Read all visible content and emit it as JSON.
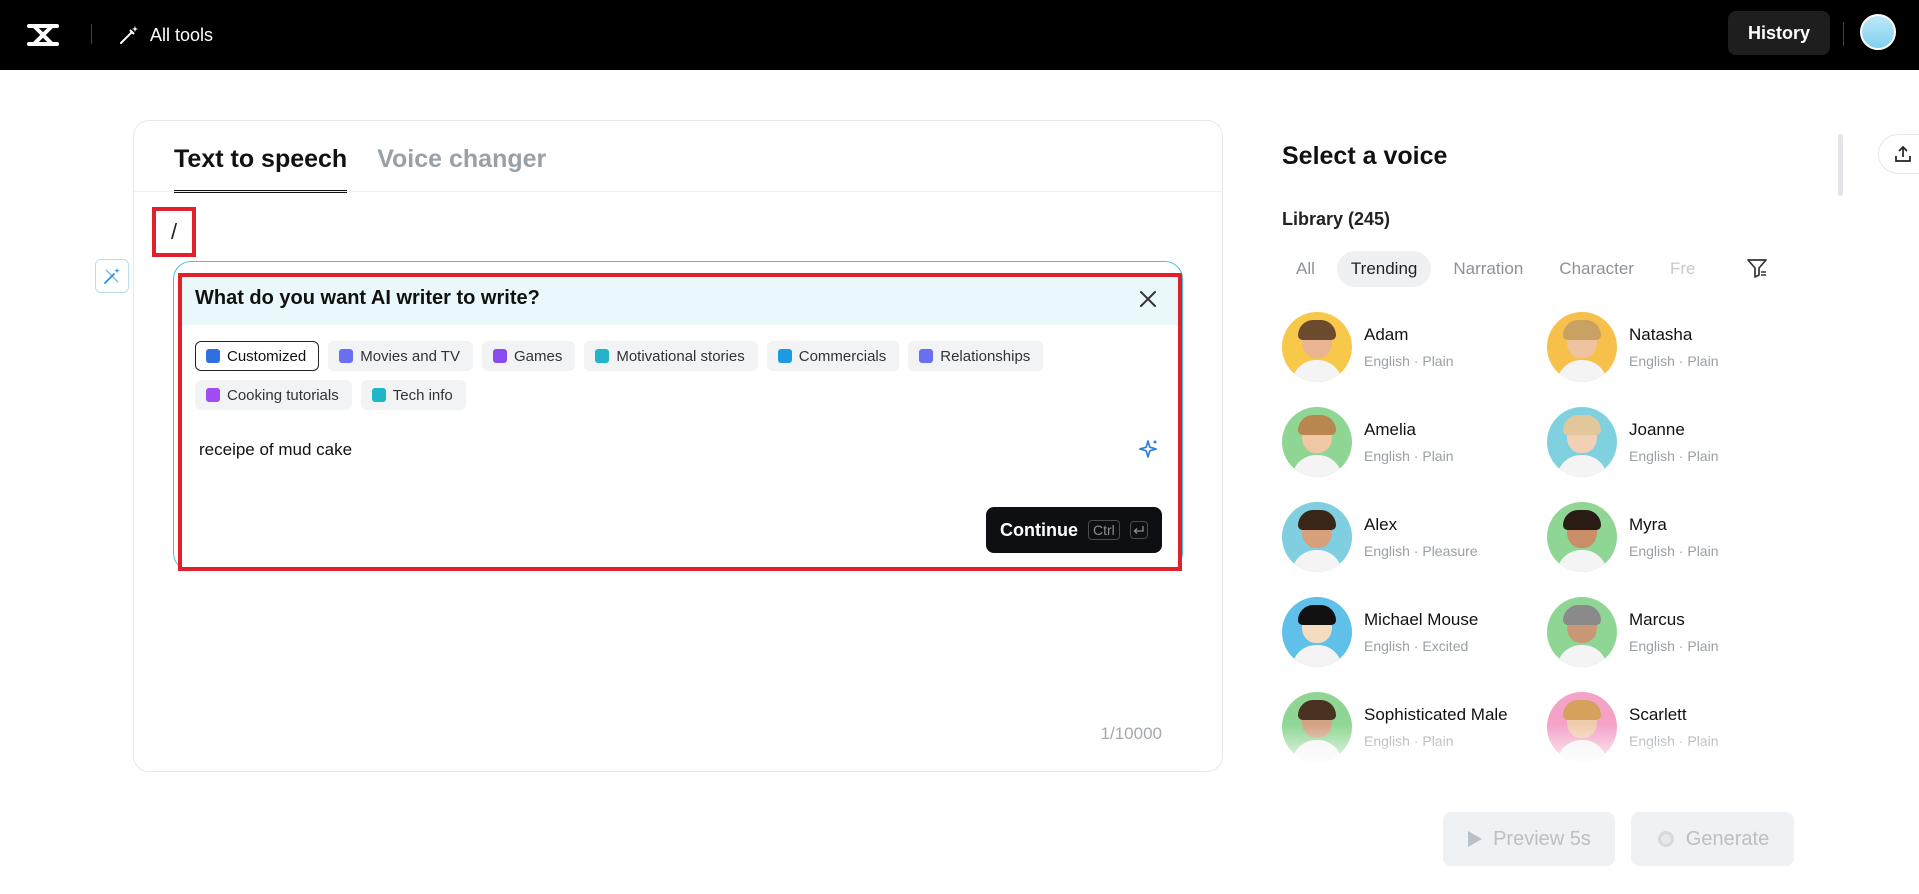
{
  "topbar": {
    "all_tools_label": "All tools",
    "history_label": "History"
  },
  "editor": {
    "tabs": [
      {
        "label": "Text to speech",
        "active": true
      },
      {
        "label": "Voice changer",
        "active": false
      }
    ],
    "text_content": "/",
    "char_count": "1/10000"
  },
  "ai_writer": {
    "title": "What do you want AI writer to write?",
    "categories": [
      {
        "label": "Customized",
        "active": true,
        "icon": "edit-icon",
        "color": "#2f6fe0"
      },
      {
        "label": "Movies and TV",
        "active": false,
        "icon": "clapperboard-icon",
        "color": "#6a6ef0"
      },
      {
        "label": "Games",
        "active": false,
        "icon": "gamepad-icon",
        "color": "#8a4bf0"
      },
      {
        "label": "Motivational stories",
        "active": false,
        "icon": "person-icon",
        "color": "#22b5c9"
      },
      {
        "label": "Commercials",
        "active": false,
        "icon": "billboard-icon",
        "color": "#1e9be0"
      },
      {
        "label": "Relationships",
        "active": false,
        "icon": "people-icon",
        "color": "#6a6ef0"
      },
      {
        "label": "Cooking tutorials",
        "active": false,
        "icon": "cup-icon",
        "color": "#a24bf0"
      },
      {
        "label": "Tech info",
        "active": false,
        "icon": "rocket-icon",
        "color": "#1eb7c9"
      }
    ],
    "prompt_value": "receipe of mud cake",
    "continue_label": "Continue",
    "shortcut_key": "Ctrl"
  },
  "voice_panel": {
    "title": "Select a voice",
    "library_label": "Library (245)",
    "filter_tabs": [
      {
        "label": "All",
        "active": false
      },
      {
        "label": "Trending",
        "active": true
      },
      {
        "label": "Narration",
        "active": false
      },
      {
        "label": "Character",
        "active": false
      },
      {
        "label": "Fre",
        "active": false
      }
    ],
    "voices": [
      {
        "name": "Adam",
        "desc": "English · Plain",
        "bg": "#f8c84a",
        "skin": "#e9b48f",
        "hair": "#6b4a2e"
      },
      {
        "name": "Natasha",
        "desc": "English · Plain",
        "bg": "#f6c04a",
        "skin": "#efc3a0",
        "hair": "#c9a263"
      },
      {
        "name": "Amelia",
        "desc": "English · Plain",
        "bg": "#8fd694",
        "skin": "#f0c8a6",
        "hair": "#b8874f"
      },
      {
        "name": "Joanne",
        "desc": "English · Plain",
        "bg": "#7fd1e0",
        "skin": "#f2d0b3",
        "hair": "#e2c79a"
      },
      {
        "name": "Alex",
        "desc": "English · Pleasure",
        "bg": "#7fcfe0",
        "skin": "#d8a07a",
        "hair": "#3a2618"
      },
      {
        "name": "Myra",
        "desc": "English · Plain",
        "bg": "#8fd694",
        "skin": "#c98e68",
        "hair": "#2a1c14"
      },
      {
        "name": "Michael Mouse",
        "desc": "English · Excited",
        "bg": "#5fc0ea",
        "skin": "#f3dcc0",
        "hair": "#111111"
      },
      {
        "name": "Marcus",
        "desc": "English · Plain",
        "bg": "#8fd694",
        "skin": "#c99877",
        "hair": "#8a8a8a"
      },
      {
        "name": "Sophisticated Male",
        "desc": "English · Plain",
        "bg": "#8fd694",
        "skin": "#d3a283",
        "hair": "#4a3222"
      },
      {
        "name": "Scarlett",
        "desc": "English · Plain",
        "bg": "#f4a3c7",
        "skin": "#f0ccae",
        "hair": "#d4a25c"
      }
    ]
  },
  "actions": {
    "preview_label": "Preview 5s",
    "generate_label": "Generate"
  }
}
